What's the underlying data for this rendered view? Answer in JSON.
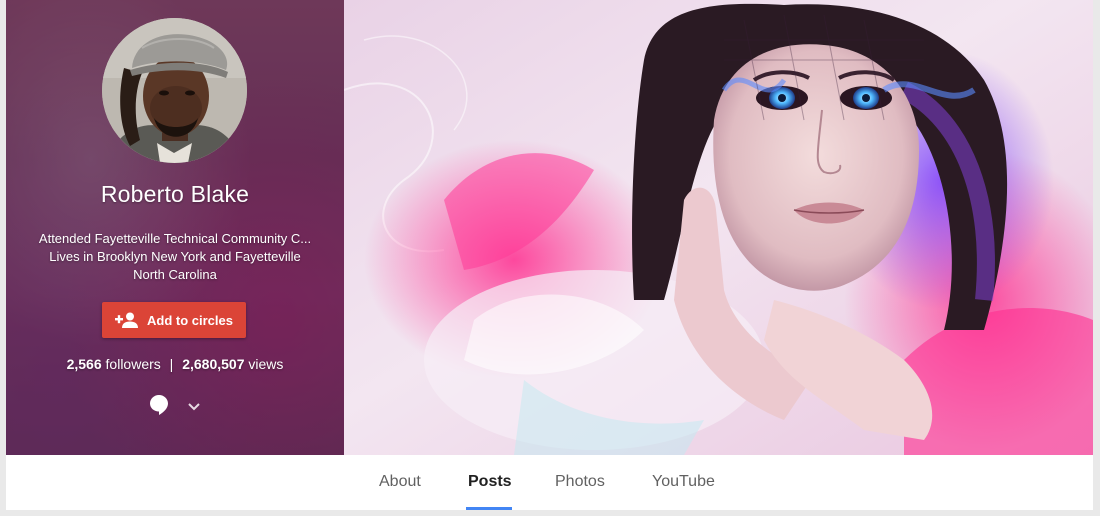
{
  "profile": {
    "name": "Roberto Blake",
    "tagline_line1": "Attended Fayetteville Technical Community C...",
    "tagline_line2": "Lives in Brooklyn New York and Fayetteville",
    "tagline_line3": "North Carolina",
    "add_button_label": "Add to circles",
    "followers_count": "2,566",
    "followers_label": "followers",
    "separator": "|",
    "views_count": "2,680,507",
    "views_label": "views"
  },
  "tabs": [
    {
      "label": "About"
    },
    {
      "label": "Posts"
    },
    {
      "label": "Photos"
    },
    {
      "label": "YouTube"
    }
  ],
  "active_tab": "Posts",
  "colors": {
    "add_button": "#db4437",
    "tab_underline": "#4285f4"
  }
}
